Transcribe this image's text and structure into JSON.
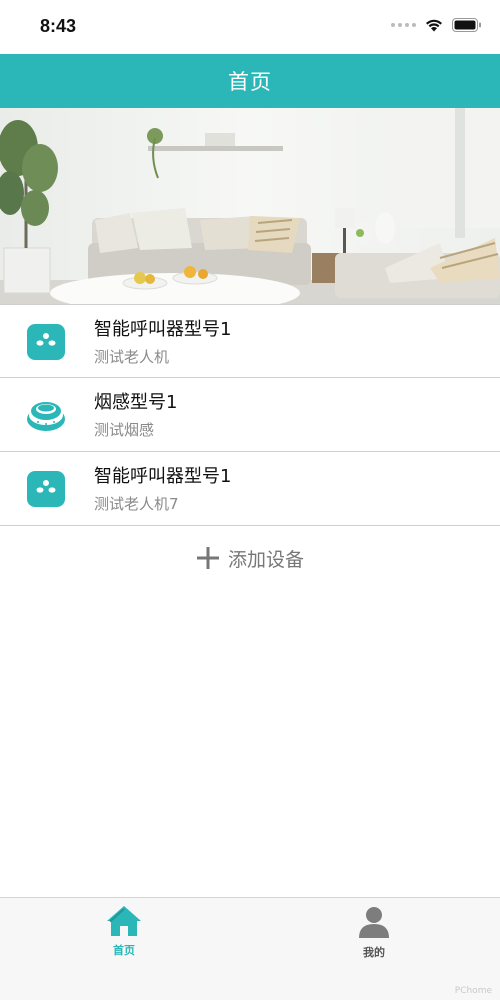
{
  "status_bar": {
    "time": "8:43"
  },
  "header": {
    "title": "首页"
  },
  "devices": [
    {
      "name": "智能呼叫器型号1",
      "subtitle": "测试老人机",
      "icon": "caller-device-icon"
    },
    {
      "name": "烟感型号1",
      "subtitle": "测试烟感",
      "icon": "smoke-detector-icon"
    },
    {
      "name": "智能呼叫器型号1",
      "subtitle": "测试老人机7",
      "icon": "caller-device-icon"
    }
  ],
  "add_device": {
    "label": "添加设备",
    "icon": "plus-icon"
  },
  "tab_bar": {
    "tabs": [
      {
        "label": "首页",
        "icon": "home-icon",
        "active": true
      },
      {
        "label": "我的",
        "icon": "person-icon",
        "active": false
      }
    ]
  },
  "watermark": "PChome",
  "colors": {
    "accent": "#2bb7b8",
    "divider": "#cfcfcf",
    "subtitle": "#8a8a8a"
  }
}
